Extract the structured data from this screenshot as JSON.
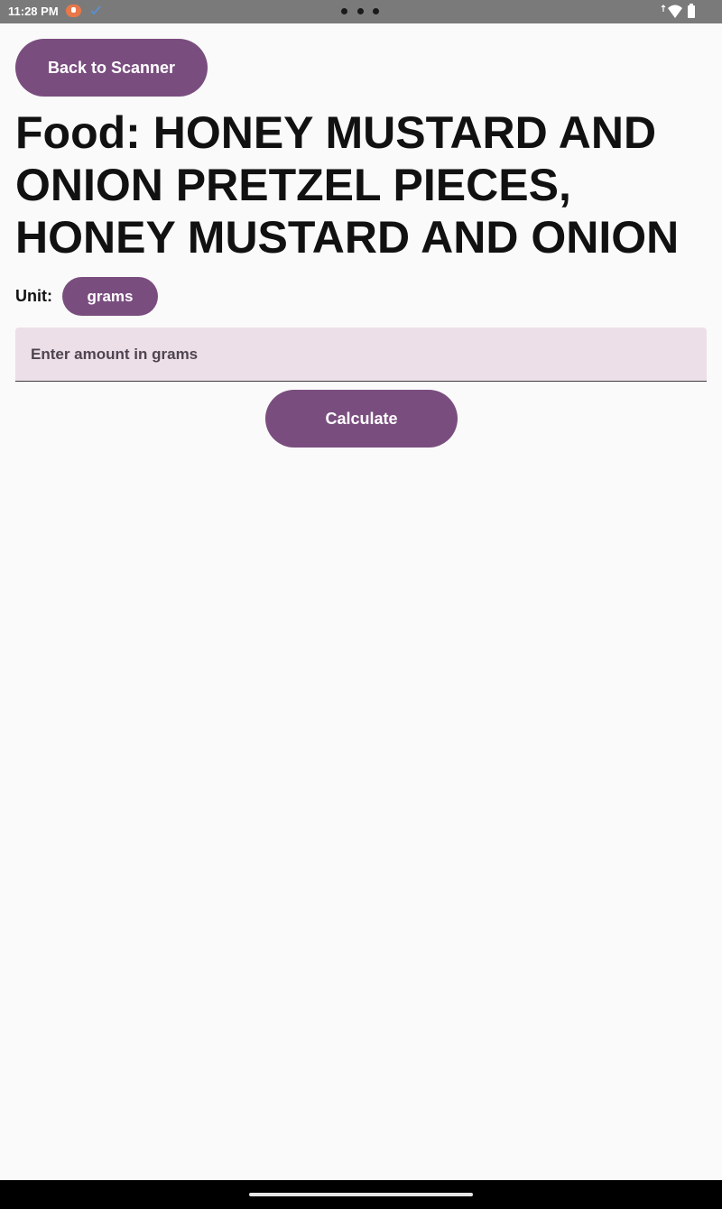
{
  "status_bar": {
    "time": "11:28 PM",
    "icons": [
      "notification-icon",
      "check-icon",
      "more-dots-icon",
      "wifi-icon",
      "battery-icon"
    ]
  },
  "header": {
    "back_label": "Back to Scanner"
  },
  "food": {
    "title": "Food: HONEY MUSTARD AND ONION PRETZEL PIECES, HONEY MUSTARD AND ONION"
  },
  "unit": {
    "label": "Unit:",
    "selected": "grams"
  },
  "amount": {
    "value": "",
    "placeholder": "Enter amount in grams"
  },
  "actions": {
    "calculate_label": "Calculate"
  },
  "colors": {
    "accent": "#7a4d7f",
    "field_bg": "#ecdfe8",
    "background": "#fafafa",
    "status_bar": "#7a7a7a"
  }
}
